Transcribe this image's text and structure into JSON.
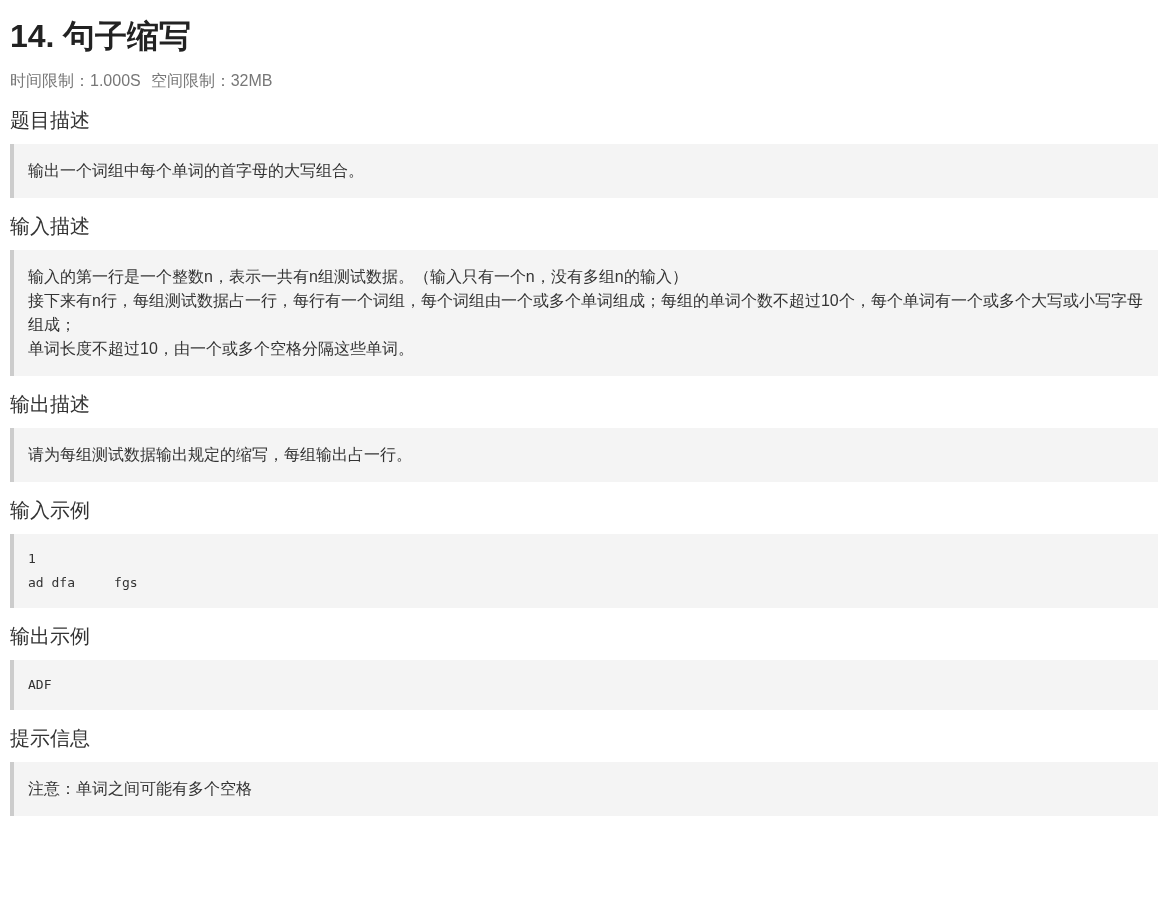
{
  "title": "14. 句子缩写",
  "limits": [
    "时间限制：1.000S",
    "空间限制：32MB"
  ],
  "sections": [
    {
      "heading": "题目描述",
      "kind": "text",
      "lines": [
        "输出一个词组中每个单词的首字母的大写组合。"
      ]
    },
    {
      "heading": "输入描述",
      "kind": "text",
      "lines": [
        "输入的第一行是一个整数n，表示一共有n组测试数据。（输入只有一个n，没有多组n的输入）",
        "接下来有n行，每组测试数据占一行，每行有一个词组，每个词组由一个或多个单词组成；每组的单词个数不超过10个，每个单词有一个或多个大写或小写字母组成；",
        "单词长度不超过10，由一个或多个空格分隔这些单词。"
      ]
    },
    {
      "heading": "输出描述",
      "kind": "text",
      "lines": [
        "请为每组测试数据输出规定的缩写，每组输出占一行。"
      ]
    },
    {
      "heading": "输入示例",
      "kind": "code",
      "lines": [
        "1",
        "ad dfa     fgs"
      ]
    },
    {
      "heading": "输出示例",
      "kind": "code",
      "lines": [
        "ADF"
      ]
    },
    {
      "heading": "提示信息",
      "kind": "text",
      "lines": [
        "注意：单词之间可能有多个空格"
      ]
    }
  ]
}
